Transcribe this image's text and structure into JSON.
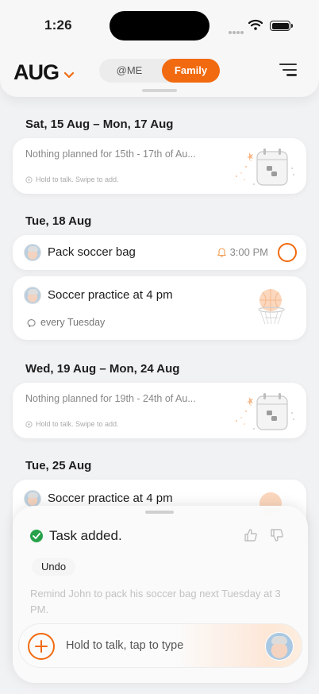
{
  "status_bar": {
    "time": "1:26"
  },
  "header": {
    "month": "AUG",
    "tabs": [
      {
        "label": "@ME",
        "selected": false
      },
      {
        "label": "Family",
        "selected": true
      }
    ]
  },
  "colors": {
    "accent": "#f26a0f",
    "success": "#27a24a"
  },
  "sections": [
    {
      "heading": "Sat, 15 Aug – Mon, 17 Aug",
      "empty": {
        "title": "Nothing planned for 15th - 17th of Au...",
        "hint": "Hold to talk. Swipe to add."
      }
    },
    {
      "heading": "Tue, 18 Aug",
      "tasks": [
        {
          "title": "Pack soccer bag",
          "reminder": "3:00 PM",
          "icon": "bell-icon"
        },
        {
          "title": "Soccer practice at 4 pm",
          "repeat": "every Tuesday",
          "icon": "repeat-icon"
        }
      ]
    },
    {
      "heading": "Wed, 19 Aug – Mon, 24 Aug",
      "empty": {
        "title": "Nothing planned for 19th - 24th of Au...",
        "hint": "Hold to talk. Swipe to add."
      }
    },
    {
      "heading": "Tue, 25 Aug",
      "tasks": [
        {
          "title": "Soccer practice at 4 pm"
        }
      ]
    }
  ],
  "sheet": {
    "toast": "Task added.",
    "undo": "Undo",
    "transcript": "Remind John to pack his soccer bag next Tuesday at 3 PM.",
    "input_placeholder": "Hold to talk, tap to type"
  }
}
